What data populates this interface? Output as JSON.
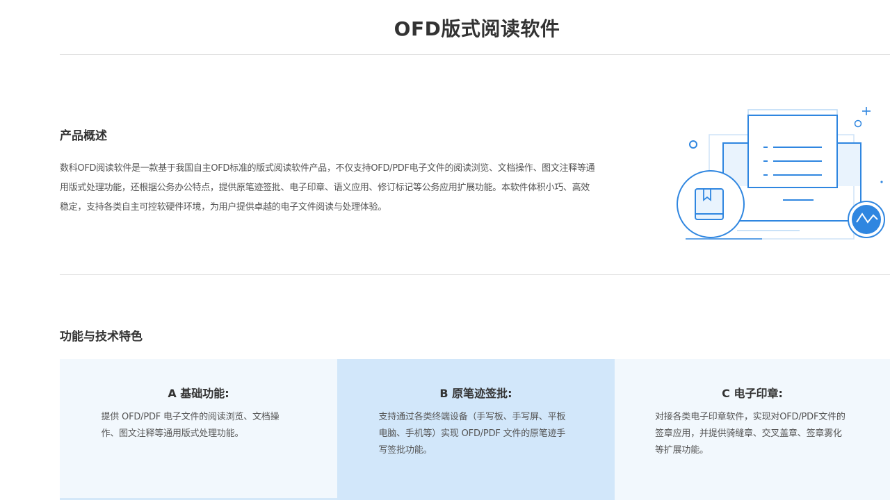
{
  "page": {
    "title": "OFD版式阅读软件"
  },
  "overview": {
    "heading": "产品概述",
    "text": "数科OFD阅读软件是一款基于我国自主OFD标准的版式阅读软件产品，不仅支持OFD/PDF电子文件的阅读浏览、文档操作、图文注释等通用版式处理功能，还根据公务办公特点，提供原笔迹签批、电子印章、语义应用、修订标记等公务应用扩展功能。本软件体积小巧、高效稳定，支持各类自主可控软硬件环境，为用户提供卓越的电子文件阅读与处理体验。",
    "illustration_icons": [
      "document-icon",
      "book-icon",
      "chart-wave-icon",
      "plus-icon"
    ]
  },
  "features": {
    "heading": "功能与技术特色",
    "cards": [
      {
        "title": "A 基础功能:",
        "desc": "提供 OFD/PDF 电子文件的阅读浏览、文档操作、图文注释等通用版式处理功能。",
        "bg_color": "#f2f8fd"
      },
      {
        "title": "B 原笔迹签批:",
        "desc": "支持通过各类终端设备（手写板、手写屏、平板电脑、手机等）实现 OFD/PDF 文件的原笔迹手写签批功能。",
        "bg_color": "#d2e7fa"
      },
      {
        "title": "C 电子印章:",
        "desc": "对接各类电子印章软件，实现对OFD/PDF文件的签章应用，并提供骑缝章、交叉盖章、签章雾化等扩展功能。",
        "bg_color": "#f2f8fd"
      }
    ]
  },
  "colors": {
    "accent": "#2f86e0",
    "accent_light": "#e4f0fc",
    "divider": "#e2e2e2"
  }
}
